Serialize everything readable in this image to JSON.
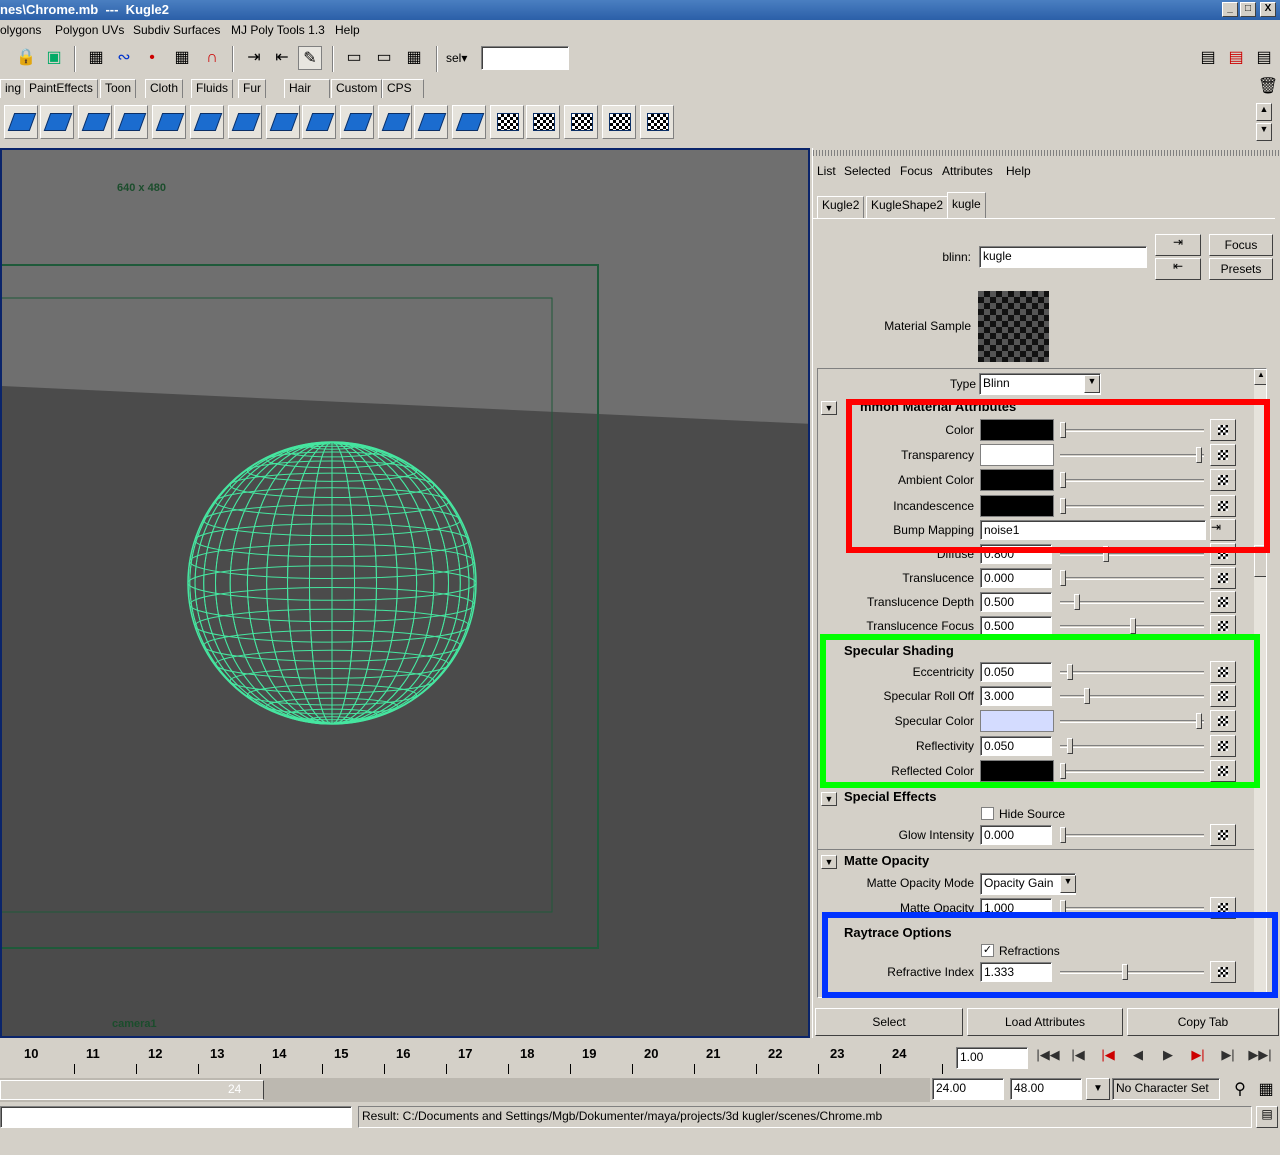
{
  "window": {
    "title": "nes\\Chrome.mb  ---  Kugle2",
    "min": "_",
    "max": "□",
    "close": "X"
  },
  "menu": [
    "olygons",
    "Polygon UVs",
    "Subdiv Surfaces",
    "MJ Poly Tools 1.3",
    "Help"
  ],
  "status": {
    "sel_label": "sel▾",
    "sel_value": ""
  },
  "shelf_tabs": [
    "ing",
    "PaintEffects",
    "Toon",
    "Cloth",
    "Fluids",
    "Fur",
    "Hair",
    "Custom",
    "CPS"
  ],
  "viewport": {
    "resolution": "640 x 480",
    "camera": "camera1",
    "wire_color": "#46e6a0"
  },
  "ae": {
    "menu": [
      "List",
      "Selected",
      "Focus",
      "Attributes",
      "Help"
    ],
    "tabs": [
      "Kugle2",
      "KugleShape2",
      "kugle"
    ],
    "node_label": "blinn:",
    "node_name": "kugle",
    "focus_label": "Focus",
    "presets_label": "Presets",
    "material_sample_label": "Material Sample",
    "type_label": "Type",
    "type_value": "Blinn",
    "common": {
      "title": "mmon Material Attributes",
      "color_label": "Color",
      "transparency_label": "Transparency",
      "ambient_label": "Ambient Color",
      "incandescence_label": "Incandescence",
      "bump_label": "Bump Mapping",
      "bump_value": "noise1",
      "diffuse_label": "Diffuse",
      "diffuse_value": "0.800",
      "translucence_label": "Translucence",
      "translucence_value": "0.000",
      "tdepth_label": "Translucence Depth",
      "tdepth_value": "0.500",
      "tfocus_label": "Translucence Focus",
      "tfocus_value": "0.500"
    },
    "specular": {
      "title": "Specular Shading",
      "ecc_label": "Eccentricity",
      "ecc_value": "0.050",
      "rolloff_label": "Specular Roll Off",
      "rolloff_value": "3.000",
      "speccolor_label": "Specular Color",
      "reflectivity_label": "Reflectivity",
      "reflectivity_value": "0.050",
      "reflcolor_label": "Reflected Color"
    },
    "special": {
      "title": "Special Effects",
      "hide_source_label": "Hide Source",
      "glow_label": "Glow Intensity",
      "glow_value": "0.000"
    },
    "matte": {
      "title": "Matte Opacity",
      "mode_label": "Matte Opacity Mode",
      "mode_value": "Opacity Gain",
      "opacity_label": "Matte Opacity",
      "opacity_value": "1.000"
    },
    "raytrace": {
      "title": "Raytrace Options",
      "refractions_label": "Refractions",
      "refractive_label": "Refractive Index",
      "refractive_value": "1.333"
    },
    "bottom_buttons": [
      "Select",
      "Load Attributes",
      "Copy Tab"
    ]
  },
  "timeline": {
    "ticks": [
      "10",
      "11",
      "12",
      "13",
      "14",
      "15",
      "16",
      "17",
      "18",
      "19",
      "20",
      "21",
      "22",
      "23",
      "24"
    ],
    "current_time": "1.00",
    "range_end_small": "24",
    "range_start": "24.00",
    "range_end": "48.00",
    "character_set": "No Character Set"
  },
  "result": "Result: C:/Documents and Settings/Mgb/Dokumenter/maya/projects/3d kugler/scenes/Chrome.mb",
  "highlights": {
    "red": "#ff0000",
    "green": "#00ff00",
    "blue": "#0033ff"
  },
  "colors": {
    "color_swatch": "#000000",
    "transparency_swatch": "#ffffff",
    "ambient_swatch": "#000000",
    "incandescence_swatch": "#000000",
    "specular_swatch": "#d4dcff",
    "reflected_swatch": "#000000"
  }
}
